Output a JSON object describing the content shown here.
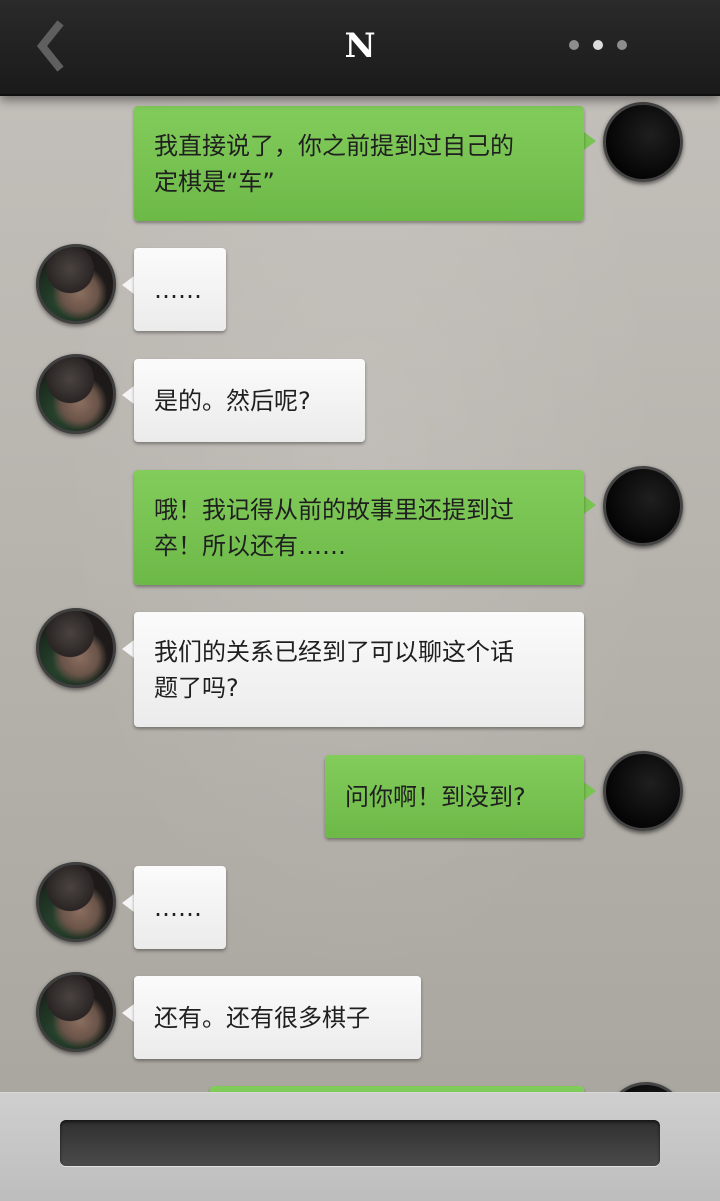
{
  "header": {
    "title": "N",
    "back_icon": "back-chevron-icon",
    "more_icon": "more-dots-icon"
  },
  "messages": [
    {
      "side": "right",
      "text": "我直接说了，你之前提到过自己的\n定棋是“车”"
    },
    {
      "side": "left",
      "text": "……"
    },
    {
      "side": "left",
      "text": "是的。然后呢?"
    },
    {
      "side": "right",
      "text": "哦！我记得从前的故事里还提到过\n卒！所以还有……"
    },
    {
      "side": "left",
      "text": "我们的关系已经到了可以聊这个话\n题了吗?"
    },
    {
      "side": "right",
      "text": "问你啊！到没到?"
    },
    {
      "side": "left",
      "text": "……"
    },
    {
      "side": "left",
      "text": "还有。还有很多棋子"
    },
    {
      "side": "right",
      "text": ""
    }
  ],
  "composer": {
    "value": "",
    "placeholder": ""
  },
  "colors": {
    "header_bg": "#222222",
    "right_bubble": "#78c351",
    "left_bubble": "#f4f4f4",
    "background": "#b9b5b0"
  }
}
